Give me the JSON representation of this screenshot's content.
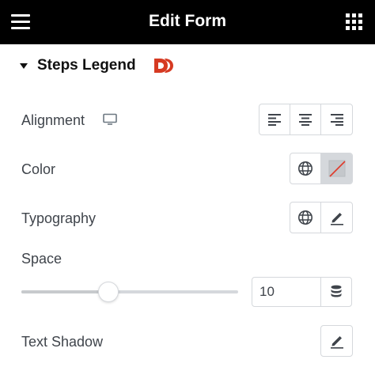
{
  "header": {
    "title": "Edit Form",
    "menu_icon": "hamburger-menu-icon",
    "apps_icon": "grid-apps-icon",
    "background": "#000000"
  },
  "section": {
    "title": "Steps Legend",
    "expanded": true,
    "brand_icon": "dynamic-tag-logo-icon",
    "brand_color": "#d63a22"
  },
  "controls": {
    "alignment": {
      "label": "Alignment",
      "device_icon": "desktop-icon",
      "options": [
        "align-left-icon",
        "align-center-icon",
        "align-right-icon"
      ]
    },
    "color": {
      "label": "Color",
      "global_icon": "globe-icon",
      "swatch_state": "none"
    },
    "typography": {
      "label": "Typography",
      "global_icon": "globe-icon",
      "edit_icon": "pencil-icon"
    },
    "space": {
      "label": "Space",
      "value": "10",
      "slider_fraction": 0.4,
      "unit_icon": "database-icon"
    },
    "text_shadow": {
      "label": "Text Shadow",
      "edit_icon": "pencil-icon"
    }
  }
}
